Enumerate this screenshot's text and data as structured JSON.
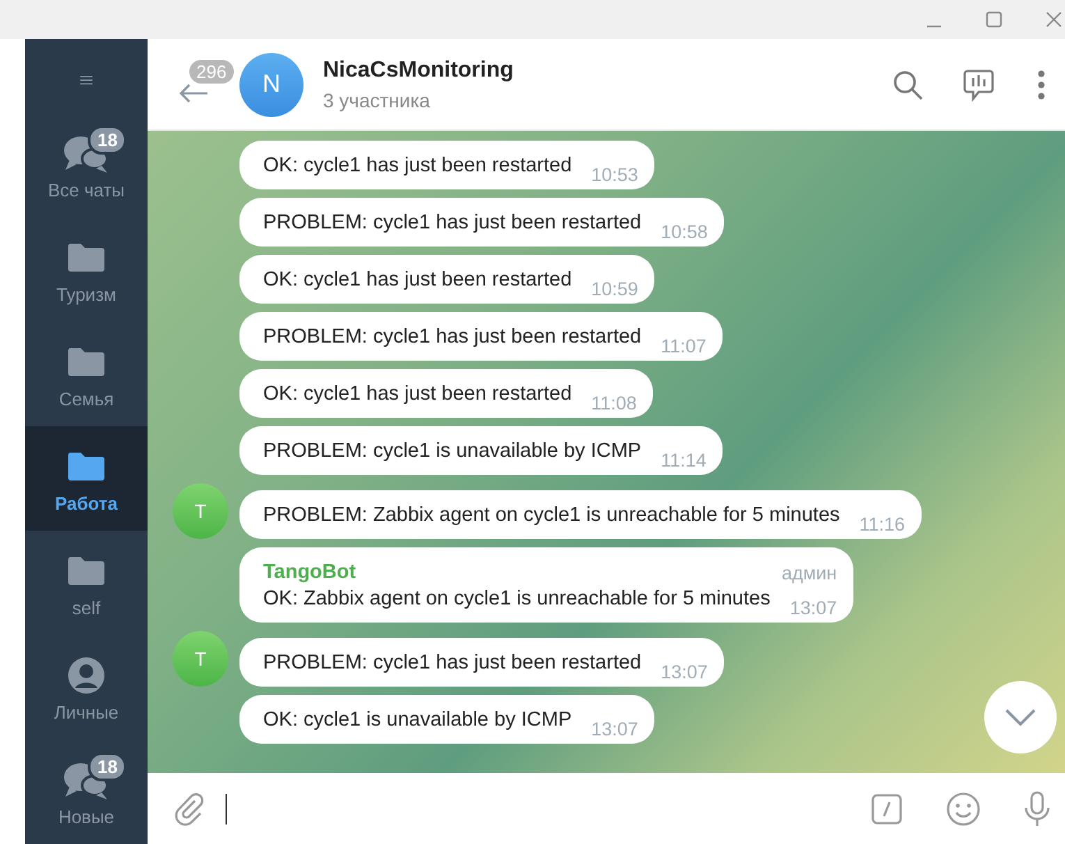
{
  "sidebar": {
    "items": [
      {
        "label": "Все чаты",
        "kind": "chats",
        "badge": "18",
        "selected": false
      },
      {
        "label": "Туризм",
        "kind": "folder",
        "selected": false
      },
      {
        "label": "Семья",
        "kind": "folder",
        "selected": false
      },
      {
        "label": "Работа",
        "kind": "folder",
        "selected": true
      },
      {
        "label": "self",
        "kind": "folder",
        "selected": false
      },
      {
        "label": "Личные",
        "kind": "person",
        "selected": false
      },
      {
        "label": "Новые",
        "kind": "chats",
        "badge": "18",
        "selected": false
      }
    ]
  },
  "header": {
    "back_badge": "296",
    "avatar_letter": "N",
    "title": "NicaCsMonitoring",
    "subtitle": "3 участника"
  },
  "messages": [
    {
      "text": "OK: cycle1 has just been restarted",
      "time": "10:53"
    },
    {
      "text": "PROBLEM: cycle1 has just been restarted",
      "time": "10:58"
    },
    {
      "text": "OK: cycle1 has just been restarted",
      "time": "10:59"
    },
    {
      "text": "PROBLEM: cycle1 has just been restarted",
      "time": "11:07"
    },
    {
      "text": "OK: cycle1 has just been restarted",
      "time": "11:08"
    },
    {
      "text": "PROBLEM: cycle1 is unavailable by ICMP",
      "time": "11:14"
    },
    {
      "text": "PROBLEM: Zabbix agent on cycle1 is unreachable for 5 minutes",
      "time": "11:16",
      "avatar": "T"
    },
    {
      "sender": "TangoBot",
      "role": "админ",
      "text": "OK: Zabbix agent on cycle1 is unreachable for 5 minutes",
      "time": "13:07"
    },
    {
      "text": "PROBLEM: cycle1 has just been restarted",
      "time": "13:07",
      "avatar": "T"
    },
    {
      "text": "OK: cycle1 is unavailable by ICMP",
      "time": "13:07"
    }
  ]
}
